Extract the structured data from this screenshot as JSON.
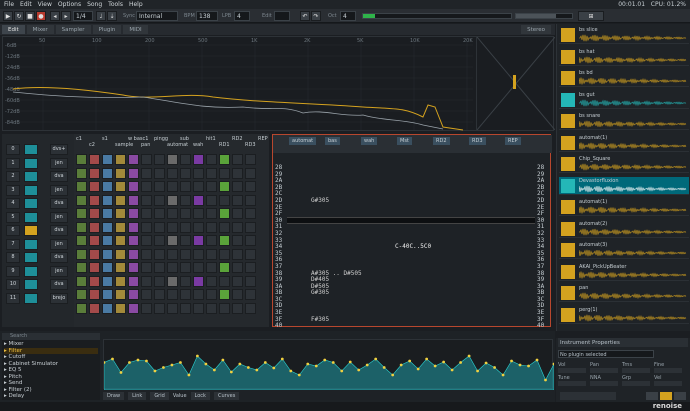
{
  "menu": [
    "File",
    "Edit",
    "View",
    "Options",
    "Song",
    "Tools",
    "Help"
  ],
  "status_right": {
    "time": "00:01.01",
    "cpu": "CPU: 01.2%"
  },
  "toolbar": {
    "pattern_num": "1/4",
    "sync_label": "Sync",
    "sync_value": "Internal",
    "bpm_label": "BPM",
    "bpm_value": "138",
    "lpb_label": "LPB",
    "lpb_value": "4",
    "edit_label": "Edit",
    "oct_label": "Oct",
    "oct_value": "4"
  },
  "tabs": [
    "Edit",
    "Mixer",
    "Sampler",
    "Plugin",
    "MIDI"
  ],
  "scope_label": "Stereo",
  "freq_labels": [
    "50",
    "100",
    "200",
    "500",
    "1K",
    "2K",
    "5K",
    "10K",
    "20K"
  ],
  "db_labels": [
    "-6dB",
    "-12dB",
    "-24dB",
    "-36dB",
    "-48dB",
    "-60dB",
    "-72dB",
    "-84dB"
  ],
  "sequencer": {
    "rows": [
      {
        "num": "0",
        "name": "dvs+"
      },
      {
        "num": "1",
        "name": "jen"
      },
      {
        "num": "2",
        "name": "dva"
      },
      {
        "num": "3",
        "name": "jen"
      },
      {
        "num": "4",
        "name": "dva"
      },
      {
        "num": "5",
        "name": "jen"
      },
      {
        "num": "6",
        "name": "dva"
      },
      {
        "num": "7",
        "name": "jen"
      },
      {
        "num": "8",
        "name": "dva"
      },
      {
        "num": "9",
        "name": "jen"
      },
      {
        "num": "10",
        "name": "dva"
      },
      {
        "num": "11",
        "name": "brejo"
      }
    ]
  },
  "matrix_headers": [
    "c1",
    "c2",
    "s1",
    "sample",
    "w basc1",
    "pan",
    "pingg",
    "automat",
    "sub",
    "wah",
    "hit1",
    "RD1",
    "RD2",
    "RD3",
    "REP"
  ],
  "pattern": {
    "columns": [
      "automat",
      "bas",
      "wah",
      "Mst",
      "RD2",
      "RD3",
      "REP"
    ],
    "line_numbers": [
      "28",
      "29",
      "2A",
      "2B",
      "2C",
      "2D",
      "2E",
      "2F",
      "30",
      "31",
      "32",
      "33",
      "34",
      "35",
      "36",
      "37",
      "38",
      "39",
      "3A",
      "3B",
      "3C",
      "3D",
      "3E",
      "3F",
      "40"
    ],
    "notes": [
      {
        "line": "2D",
        "text": "G#305"
      },
      {
        "line": "30",
        "text": "A#305"
      },
      {
        "line": "34",
        "text": "C-40C..5C0"
      },
      {
        "line": "38",
        "text": "A#305 .. D#505"
      },
      {
        "line": "39",
        "text": "D#405"
      },
      {
        "line": "3A",
        "text": "D#505"
      },
      {
        "line": "3B",
        "text": "G#305"
      },
      {
        "line": "3F",
        "text": "F#305"
      }
    ]
  },
  "samples": [
    {
      "name": "bs slice",
      "cy": false
    },
    {
      "name": "bs hat",
      "cy": false
    },
    {
      "name": "bs bd",
      "cy": false
    },
    {
      "name": "bs gut",
      "cy": true
    },
    {
      "name": "bs snare",
      "cy": false
    },
    {
      "name": "automat(1)",
      "cy": false
    },
    {
      "name": "Chip_Square",
      "cy": false
    },
    {
      "name": "Devastorfluxion",
      "cy": true,
      "selected": true
    },
    {
      "name": "automat(1)",
      "cy": false
    },
    {
      "name": "automat(2)",
      "cy": false
    },
    {
      "name": "automat(3)",
      "cy": false
    },
    {
      "name": "AKAI_PickUpBeater",
      "cy": false
    },
    {
      "name": "pan",
      "cy": false
    },
    {
      "name": "perg(1)",
      "cy": false
    }
  ],
  "instrument": {
    "title": "Instrument Properties",
    "plugin_value": "No plugin selected",
    "params": [
      "Vol",
      "Pan",
      "Trns",
      "Fine",
      "Tune",
      "NNA",
      "Grp",
      "Vel"
    ]
  },
  "dsp_list": [
    "Mixer",
    "Filter",
    "Cutoff",
    "Cabinet Simulator",
    "EQ 5",
    "Pitch",
    "Send",
    "Filter (2)",
    "Delay"
  ],
  "automation": {
    "search_placeholder": "Search",
    "draw_label": "Draw",
    "link_label": "Link",
    "grid_label": "Grid",
    "value_label": "Value",
    "lock_label": "Lock",
    "curves_label": "Curves",
    "points": [
      0.55,
      0.62,
      0.35,
      0.55,
      0.6,
      0.58,
      0.38,
      0.45,
      0.5,
      0.55,
      0.3,
      0.68,
      0.52,
      0.4,
      0.6,
      0.36,
      0.52,
      0.45,
      0.4,
      0.55,
      0.44,
      0.62,
      0.38,
      0.3,
      0.52,
      0.48,
      0.6,
      0.55,
      0.38,
      0.56,
      0.4,
      0.5,
      0.62,
      0.45,
      0.3,
      0.5,
      0.58,
      0.42,
      0.62,
      0.48,
      0.56,
      0.4,
      0.55,
      0.68,
      0.38,
      0.54,
      0.45,
      0.3,
      0.58,
      0.5,
      0.48,
      0.6,
      0.2,
      0.52
    ]
  },
  "logo": "renoise",
  "colors": {
    "accent": "#d4a21f",
    "cyan": "#24b7b7",
    "selection": "#b8472e"
  }
}
